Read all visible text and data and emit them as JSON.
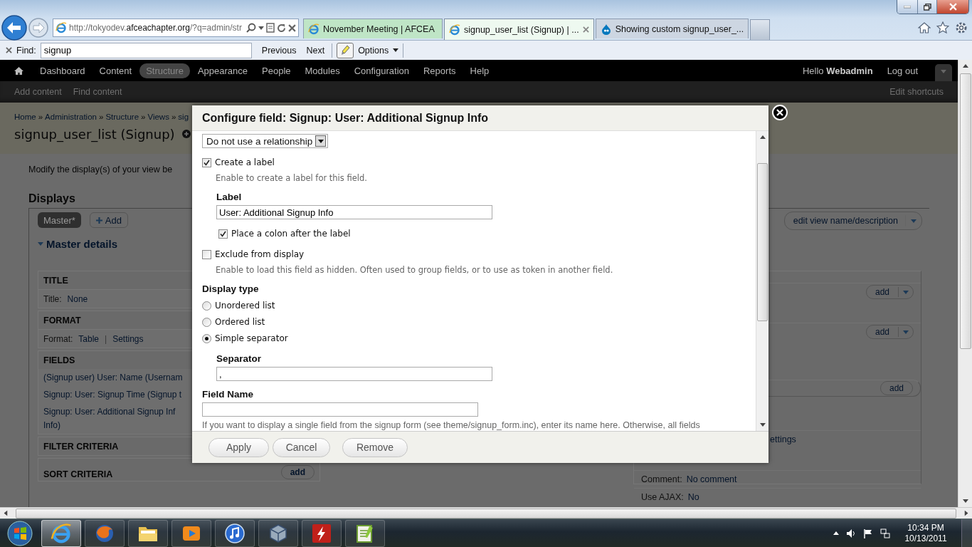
{
  "browser": {
    "url": "http://tokyodev.**afceachapter.org**/?q=admin/str",
    "tabs": [
      {
        "title": "November Meeting | AFCEA",
        "kind": "ie",
        "color": "#bfe5c6",
        "selected": false
      },
      {
        "title": "signup_user_list (Signup) | ...",
        "kind": "ie",
        "color": "#eef9f0",
        "selected": true
      },
      {
        "title": "Showing custom signup_user_...",
        "kind": "drupal",
        "color": "#cdd6e2",
        "selected": false
      }
    ],
    "find": {
      "label": "Find:",
      "value": "signup",
      "previous": "Previous",
      "next": "Next",
      "options": "Options"
    }
  },
  "toolbar": {
    "items": [
      {
        "label": "Dashboard",
        "selected": false
      },
      {
        "label": "Content",
        "selected": false
      },
      {
        "label": "Structure",
        "selected": true
      },
      {
        "label": "Appearance",
        "selected": false
      },
      {
        "label": "People",
        "selected": false
      },
      {
        "label": "Modules",
        "selected": false
      },
      {
        "label": "Configuration",
        "selected": false
      },
      {
        "label": "Reports",
        "selected": false
      },
      {
        "label": "Help",
        "selected": false
      }
    ],
    "greeting": "Hello **Webadmin**",
    "logout": "Log out"
  },
  "shortcuts": {
    "items": [
      "Add content",
      "Find content"
    ],
    "edit": "Edit shortcuts"
  },
  "page": {
    "breadcrumb": {
      "items": [
        "Home",
        "Administration",
        "Structure",
        "Views",
        "sig"
      ],
      "separator": "»"
    },
    "title": "signup_user_list (Signup)",
    "description": "Modify the display(s) of your view be",
    "displays_heading": "Displays",
    "display_tabs": [
      {
        "label": "Master*",
        "selected": true
      },
      {
        "label": "Add",
        "selected": false
      }
    ],
    "edit_view": "edit view name/description",
    "details": "Master details",
    "left_sections": [
      {
        "heading": "TITLE",
        "rows": [
          {
            "kind": "setting",
            "label": "Title:",
            "values": [
              "None"
            ]
          }
        ]
      },
      {
        "heading": "FORMAT",
        "rows": [
          {
            "kind": "setting",
            "label": "Format:",
            "values": [
              "Table",
              "Settings"
            ],
            "separator": "|"
          }
        ]
      },
      {
        "heading": "FIELDS",
        "rows": [
          {
            "kind": "link",
            "text": "(Signup user) User: Name (Usernam"
          },
          {
            "kind": "link",
            "text": "Signup: User: Signup Time (Signup t"
          },
          {
            "kind": "link",
            "text": "Signup: User: Additional Signup Inf"
          },
          {
            "kind": "wrap",
            "text": "Info)"
          }
        ]
      },
      {
        "heading": "FILTER CRITERIA"
      },
      {
        "heading": "SORT CRITERIA",
        "add": "add"
      }
    ],
    "right_rows": [
      {
        "kind": "add_dropdown",
        "label": "add"
      },
      {
        "kind": "add_dropdown",
        "label": "add"
      },
      {
        "kind": "add",
        "label": "add"
      },
      {
        "kind": "link",
        "text": "ettings"
      },
      {
        "kind": "setting",
        "label": "Comment:",
        "value": "No comment"
      },
      {
        "kind": "setting",
        "label": "Use AJAX:",
        "value": "No"
      }
    ]
  },
  "dialog": {
    "title": "Configure field: Signup: User: Additional Signup Info",
    "relationship": "Do not use a relationship",
    "create_label": {
      "label": "Create a label",
      "checked": true,
      "help": "Enable to create a label for this field."
    },
    "label_heading": "Label",
    "label_value": "User: Additional Signup Info",
    "colon": {
      "label": "Place a colon after the label",
      "checked": true
    },
    "exclude": {
      "label": "Exclude from display",
      "checked": false,
      "help": "Enable to load this field as hidden. Often used to group fields, or to use as token in another field."
    },
    "display_type": {
      "heading": "Display type",
      "options": [
        {
          "label": "Unordered list",
          "selected": false
        },
        {
          "label": "Ordered list",
          "selected": false
        },
        {
          "label": "Simple separator",
          "selected": true
        }
      ]
    },
    "separator": {
      "heading": "Separator",
      "value": ","
    },
    "field_name": {
      "heading": "Field Name",
      "help": "If you want to display a single field from the signup form (see theme/signup_form.inc), enter its name here. Otherwise, all fields"
    },
    "buttons": [
      "Apply",
      "Cancel",
      "Remove"
    ]
  },
  "taskbar": {
    "apps": [
      {
        "kind": "ie",
        "selected": true
      },
      {
        "kind": "firefox",
        "selected": false
      },
      {
        "kind": "explorer",
        "selected": false
      },
      {
        "kind": "media",
        "selected": false
      },
      {
        "kind": "itunes",
        "selected": false
      },
      {
        "kind": "virtualbox",
        "selected": false
      },
      {
        "kind": "filezilla",
        "selected": false
      },
      {
        "kind": "notepad",
        "selected": false
      }
    ],
    "time": "10:34 PM",
    "date": "10/13/2011"
  }
}
